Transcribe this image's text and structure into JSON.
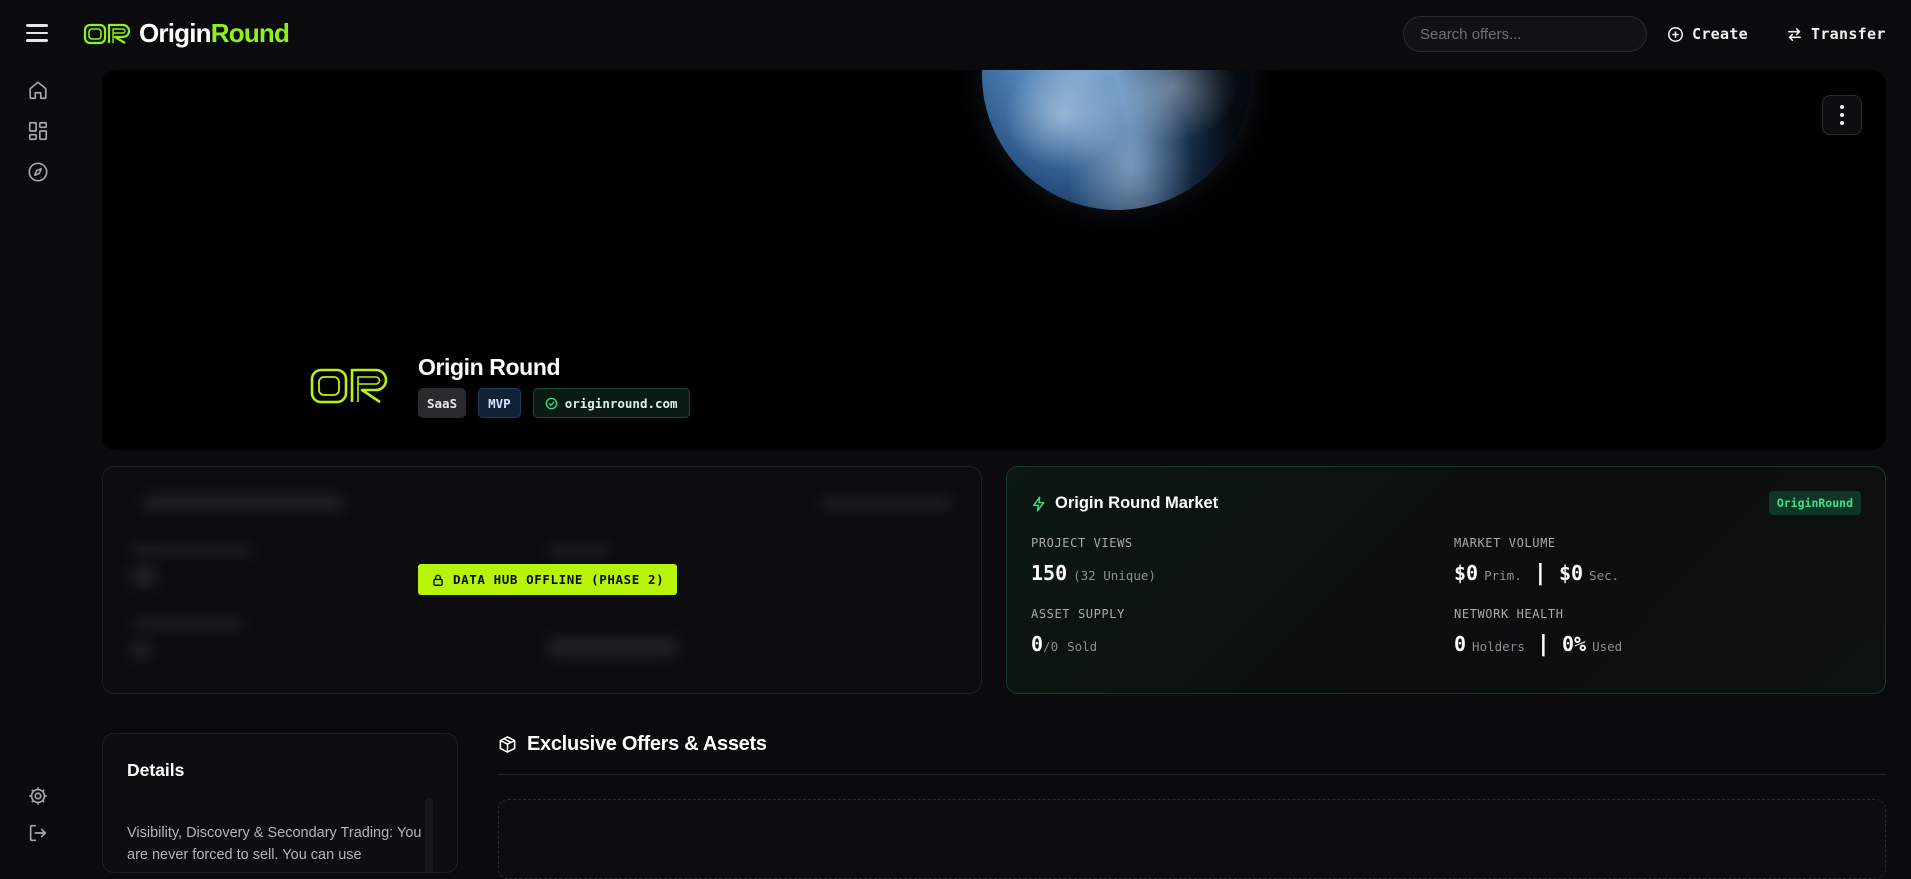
{
  "app": {
    "brand_part1": "Origin",
    "brand_part2": "Round",
    "accent_color": "#8cf21a"
  },
  "header": {
    "search_placeholder": "Search offers...",
    "create_label": "Create",
    "transfer_label": "Transfer"
  },
  "rail": {
    "icons": [
      "home-icon",
      "grid-icon",
      "compass-icon",
      "settings-icon",
      "logout-icon"
    ]
  },
  "project": {
    "name": "Origin Round",
    "tags": [
      "SaaS",
      "MVP"
    ],
    "website": "originround.com"
  },
  "hub": {
    "badge": "DATA HUB OFFLINE (PHASE 2)"
  },
  "market": {
    "title": "Origin Round Market",
    "tag": "OriginRound",
    "project_views_label": "PROJECT VIEWS",
    "project_views_value": "150",
    "project_views_unique": "(32 Unique)",
    "market_volume_label": "MARKET VOLUME",
    "primary_value": "$0",
    "primary_suffix": "Prim.",
    "secondary_value": "$0",
    "secondary_suffix": "Sec.",
    "asset_supply_label": "ASSET SUPPLY",
    "asset_supply_value": "0",
    "asset_supply_total": "/0",
    "asset_supply_suffix": "Sold",
    "network_health_label": "NETWORK HEALTH",
    "holders_value": "0",
    "holders_suffix": "Holders",
    "used_value": "0%",
    "used_suffix": "Used"
  },
  "details": {
    "title": "Details",
    "text": "Visibility, Discovery & Secondary Trading: You are never forced to sell. You can use"
  },
  "offers": {
    "title": "Exclusive Offers & Assets"
  }
}
